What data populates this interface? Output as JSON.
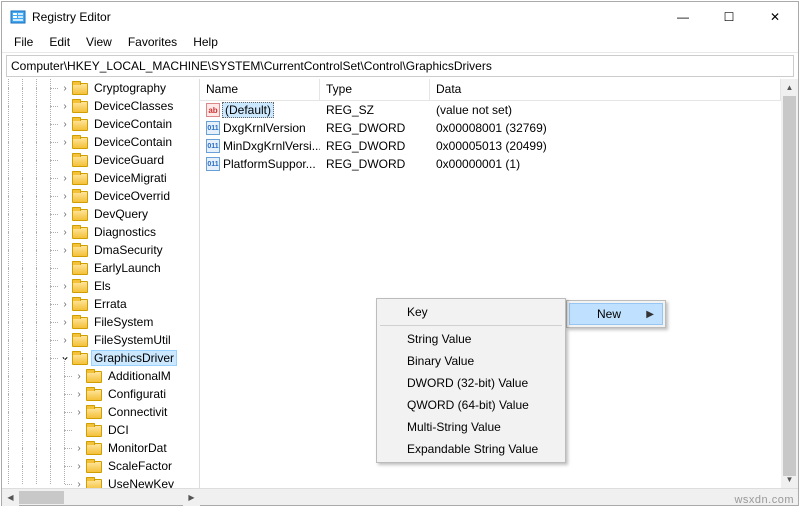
{
  "window": {
    "title": "Registry Editor"
  },
  "menubar": [
    "File",
    "Edit",
    "View",
    "Favorites",
    "Help"
  ],
  "address": "Computer\\HKEY_LOCAL_MACHINE\\SYSTEM\\CurrentControlSet\\Control\\GraphicsDrivers",
  "tree": [
    {
      "label": "Cryptography",
      "depth": 4,
      "expander": ">"
    },
    {
      "label": "DeviceClasses",
      "depth": 4,
      "expander": ">"
    },
    {
      "label": "DeviceContain",
      "depth": 4,
      "expander": ">"
    },
    {
      "label": "DeviceContain",
      "depth": 4,
      "expander": ">"
    },
    {
      "label": "DeviceGuard",
      "depth": 4,
      "expander": ""
    },
    {
      "label": "DeviceMigrati",
      "depth": 4,
      "expander": ">"
    },
    {
      "label": "DeviceOverrid",
      "depth": 4,
      "expander": ">"
    },
    {
      "label": "DevQuery",
      "depth": 4,
      "expander": ">"
    },
    {
      "label": "Diagnostics",
      "depth": 4,
      "expander": ">"
    },
    {
      "label": "DmaSecurity",
      "depth": 4,
      "expander": ">"
    },
    {
      "label": "EarlyLaunch",
      "depth": 4,
      "expander": ""
    },
    {
      "label": "Els",
      "depth": 4,
      "expander": ">"
    },
    {
      "label": "Errata",
      "depth": 4,
      "expander": ">"
    },
    {
      "label": "FileSystem",
      "depth": 4,
      "expander": ">"
    },
    {
      "label": "FileSystemUtil",
      "depth": 4,
      "expander": ">"
    },
    {
      "label": "GraphicsDriver",
      "depth": 4,
      "expander": "v",
      "selected": true
    },
    {
      "label": "AdditionalM",
      "depth": 5,
      "expander": ">"
    },
    {
      "label": "Configurati",
      "depth": 5,
      "expander": ">"
    },
    {
      "label": "Connectivit",
      "depth": 5,
      "expander": ">"
    },
    {
      "label": "DCI",
      "depth": 5,
      "expander": ""
    },
    {
      "label": "MonitorDat",
      "depth": 5,
      "expander": ">"
    },
    {
      "label": "ScaleFactor",
      "depth": 5,
      "expander": ">"
    },
    {
      "label": "UseNewKey",
      "depth": 5,
      "expander": ">"
    }
  ],
  "columns": {
    "name": "Name",
    "type": "Type",
    "data": "Data"
  },
  "values": [
    {
      "icon": "str",
      "name": "(Default)",
      "type": "REG_SZ",
      "data": "(value not set)",
      "selected": true
    },
    {
      "icon": "bin",
      "name": "DxgKrnlVersion",
      "type": "REG_DWORD",
      "data": "0x00008001 (32769)"
    },
    {
      "icon": "bin",
      "name": "MinDxgKrnlVersi...",
      "type": "REG_DWORD",
      "data": "0x00005013 (20499)"
    },
    {
      "icon": "bin",
      "name": "PlatformSuppor...",
      "type": "REG_DWORD",
      "data": "0x00000001 (1)"
    }
  ],
  "context_parent": {
    "new": "New"
  },
  "context_new": [
    "Key",
    "String Value",
    "Binary Value",
    "DWORD (32-bit) Value",
    "QWORD (64-bit) Value",
    "Multi-String Value",
    "Expandable String Value"
  ],
  "watermark": "wsxdn.com"
}
